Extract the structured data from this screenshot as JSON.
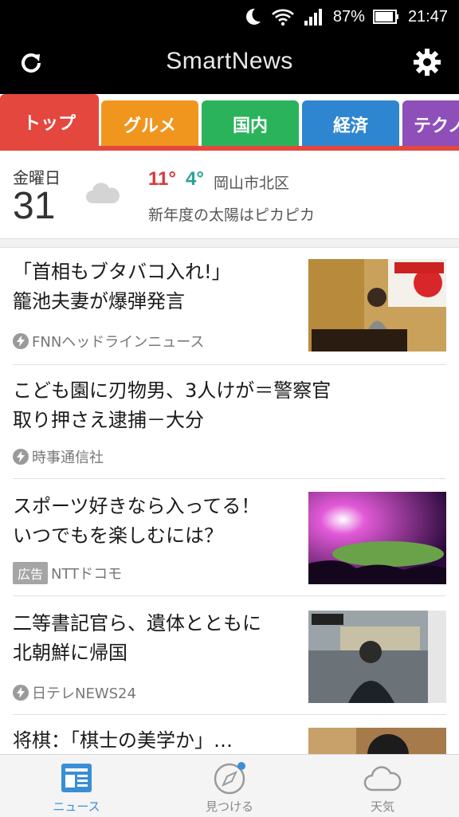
{
  "status_bar": {
    "battery": "87%",
    "time": "21:47"
  },
  "app_bar": {
    "title": "SmartNews"
  },
  "tabs": [
    {
      "label": "トップ",
      "color": "#e4473d"
    },
    {
      "label": "グルメ",
      "color": "#f0961e"
    },
    {
      "label": "国内",
      "color": "#2bb35b"
    },
    {
      "label": "経済",
      "color": "#2f86d0"
    },
    {
      "label": "テクノ",
      "color": "#8e4fb9"
    }
  ],
  "weather": {
    "weekday": "金曜日",
    "date": "31",
    "high": "11°",
    "low": "4°",
    "location": "岡山市北区",
    "message": "新年度の太陽はピカピカ"
  },
  "articles": [
    {
      "title_1": "「首相もブタバコ入れ!」",
      "title_2": "籠池夫妻が爆弾発言",
      "source": "FNNヘッドラインニュース"
    },
    {
      "title_1": "こども園に刃物男、3人けが＝警察官",
      "title_2": "取り押さえ逮捕－大分",
      "source": "時事通信社"
    },
    {
      "title_1": "スポーツ好きなら入ってる！",
      "title_2": "いつでもを楽しむには？",
      "ad_label": "広告",
      "source": "NTTドコモ"
    },
    {
      "title_1": "二等書記官ら、遺体とともに",
      "title_2": "北朝鮮に帰国",
      "source": "日テレNEWS24"
    },
    {
      "title_1": "将棋：「棋士の美学か」…"
    }
  ],
  "bottom_nav": [
    {
      "label": "ニュース"
    },
    {
      "label": "見つける"
    },
    {
      "label": "天気"
    }
  ]
}
